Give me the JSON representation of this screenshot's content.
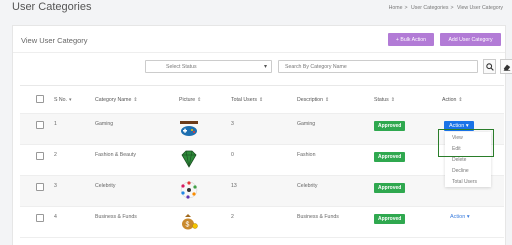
{
  "page": {
    "title": "User Categories",
    "breadcrumb": [
      "Home",
      "User Categories",
      "View User Category"
    ]
  },
  "card": {
    "title": "View User Category",
    "bulk_action_label": "+ Bulk Action",
    "add_label": "Add User Category"
  },
  "filters": {
    "status_placeholder": "Select Status",
    "search_placeholder": "Search By Category Name"
  },
  "table": {
    "headers": {
      "sno": "S No.",
      "name": "Category Name",
      "picture": "Picture",
      "users": "Total Users",
      "desc": "Description",
      "status": "Status",
      "action": "Action"
    },
    "rows": [
      {
        "sno": "1",
        "name": "Gaming",
        "icon": "gamepad-icon",
        "users": "3",
        "desc": "Gaming",
        "status": "Approved",
        "action": "Action"
      },
      {
        "sno": "2",
        "name": "Fashion & Beauty",
        "icon": "gem-icon",
        "users": "0",
        "desc": "Fashion",
        "status": "Approved",
        "action": "Action"
      },
      {
        "sno": "3",
        "name": "Celebrity",
        "icon": "star-cluster-icon",
        "users": "13",
        "desc": "Celebrity",
        "status": "Approved",
        "action": "Action"
      },
      {
        "sno": "4",
        "name": "Business & Funds",
        "icon": "money-bag-icon",
        "users": "2",
        "desc": "Business & Funds",
        "status": "Approved",
        "action": "Action"
      }
    ]
  },
  "action_menu": [
    "View",
    "Edit",
    "Delete",
    "Decline",
    "Total Users"
  ],
  "colors": {
    "purple_button": "#b27bd6",
    "approved_green": "#2fa84f",
    "action_blue": "#1a73e8",
    "highlight_border": "#2a7d2a"
  }
}
